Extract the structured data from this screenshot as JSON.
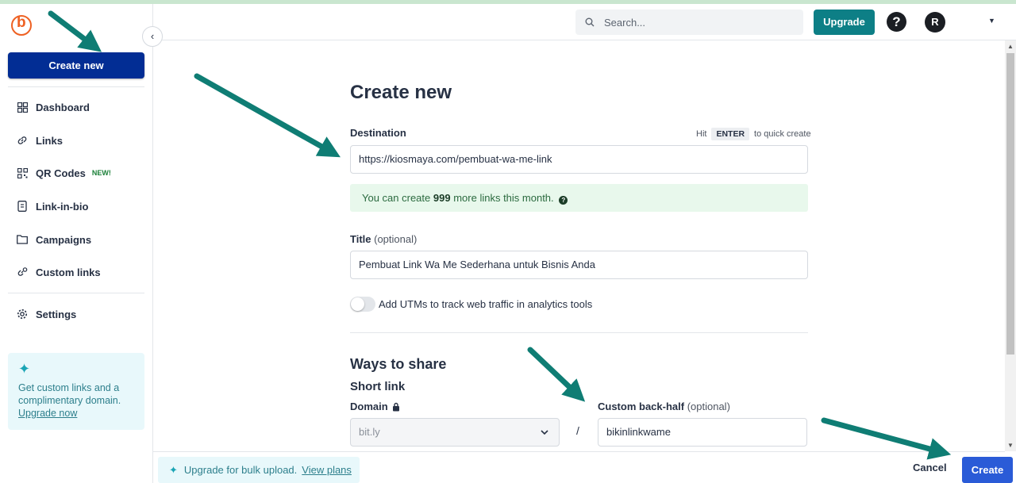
{
  "sidebar": {
    "create_new": "Create new",
    "items": [
      {
        "label": "Dashboard",
        "icon": "dashboard-grid-icon"
      },
      {
        "label": "Links",
        "icon": "link-icon"
      },
      {
        "label": "QR Codes",
        "icon": "qr-code-icon",
        "badge": "NEW!"
      },
      {
        "label": "Link-in-bio",
        "icon": "phone-page-icon"
      },
      {
        "label": "Campaigns",
        "icon": "folder-icon"
      },
      {
        "label": "Custom links",
        "icon": "custom-link-icon"
      }
    ],
    "settings": {
      "label": "Settings",
      "icon": "gear-icon"
    },
    "promo": {
      "text": "Get custom links and a complimentary domain.",
      "link": "Upgrade now"
    }
  },
  "header": {
    "search_placeholder": "Search...",
    "upgrade": "Upgrade",
    "help": "?",
    "avatar_initial": "R"
  },
  "form": {
    "title": "Create new",
    "destination_label": "Destination",
    "hint_prefix": "Hit",
    "hint_key": "ENTER",
    "hint_suffix": "to quick create",
    "destination_value": "https://kiosmaya.com/pembuat-wa-me-link",
    "notice_prefix": "You can create",
    "notice_count": "999",
    "notice_suffix": "more links this month.",
    "title_label": "Title",
    "optional": "(optional)",
    "title_value": "Pembuat Link Wa Me Sederhana untuk Bisnis Anda",
    "utm_toggle_label": "Add UTMs to track web traffic in analytics tools",
    "utm_enabled": false,
    "ways_to_share": "Ways to share",
    "short_link": "Short link",
    "domain_label": "Domain",
    "domain_value": "bit.ly",
    "slash": "/",
    "back_half_label": "Custom back-half",
    "back_half_value": "bikinlinkwame"
  },
  "footer": {
    "bulk_text": "Upgrade for bulk upload.",
    "bulk_link": "View plans",
    "cancel": "Cancel",
    "create": "Create"
  },
  "colors": {
    "primary_navy": "#022d94",
    "teal": "#0d7f86",
    "create_blue": "#2a5bd7",
    "arrow": "#0f7d74",
    "logo_orange": "#ee6123"
  }
}
